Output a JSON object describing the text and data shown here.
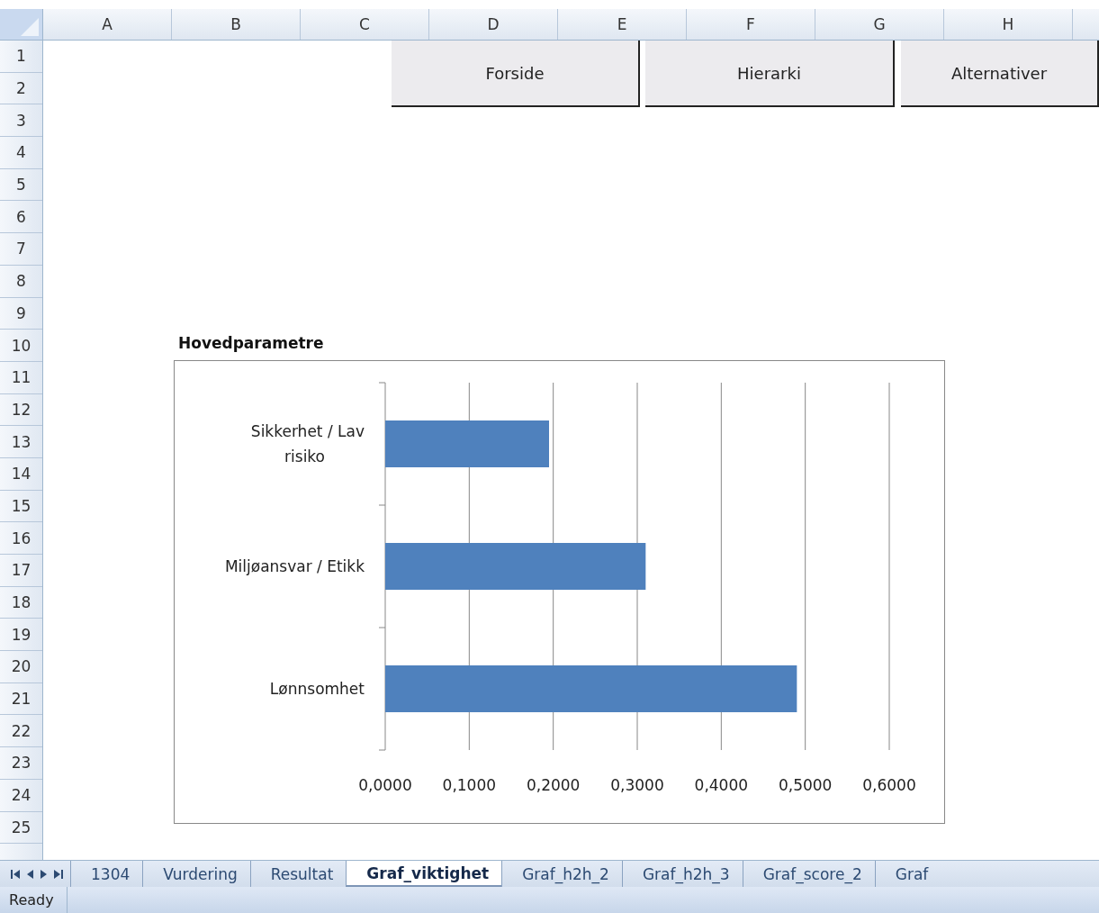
{
  "columns": [
    "A",
    "B",
    "C",
    "D",
    "E",
    "F",
    "G",
    "H"
  ],
  "rows": [
    "1",
    "2",
    "3",
    "4",
    "5",
    "6",
    "7",
    "8",
    "9",
    "10",
    "11",
    "12",
    "13",
    "14",
    "15",
    "16",
    "17",
    "18",
    "19",
    "20",
    "21",
    "22",
    "23",
    "24",
    "25"
  ],
  "buttons": [
    "Forside",
    "Hierarki",
    "Alternativer"
  ],
  "chart": {
    "chart_data": {
      "type": "bar",
      "orientation": "horizontal",
      "title": "Hovedparametre",
      "categories": [
        "Sikkerhet / Lav risiko",
        "Miljøansvar / Etikk",
        "Lønnsomhet"
      ],
      "grid": true,
      "series": [
        {
          "color": "#4f81bd",
          "values": [
            0.195,
            0.31,
            0.49
          ]
        }
      ],
      "xlim": [
        0,
        0.6
      ],
      "xticks": [
        {
          "value": 0,
          "label": "0,0000"
        },
        {
          "value": 0.1,
          "label": "0,1000"
        },
        {
          "value": 0.2,
          "label": "0,2000"
        },
        {
          "value": 0.3,
          "label": "0,3000"
        },
        {
          "value": 0.4,
          "label": "0,4000"
        },
        {
          "value": 0.5,
          "label": "0,5000"
        },
        {
          "value": 0.6,
          "label": "0,6000"
        }
      ]
    }
  },
  "sheet_tabs": [
    {
      "label": "1304",
      "selected": false
    },
    {
      "label": "Vurdering",
      "selected": false
    },
    {
      "label": "Resultat",
      "selected": false
    },
    {
      "label": "Graf_viktighet",
      "selected": true
    },
    {
      "label": "Graf_h2h_2",
      "selected": false
    },
    {
      "label": "Graf_h2h_3",
      "selected": false
    },
    {
      "label": "Graf_score_2",
      "selected": false
    },
    {
      "label": "Graf",
      "selected": false
    }
  ],
  "status_bar": {
    "text": "Ready"
  }
}
